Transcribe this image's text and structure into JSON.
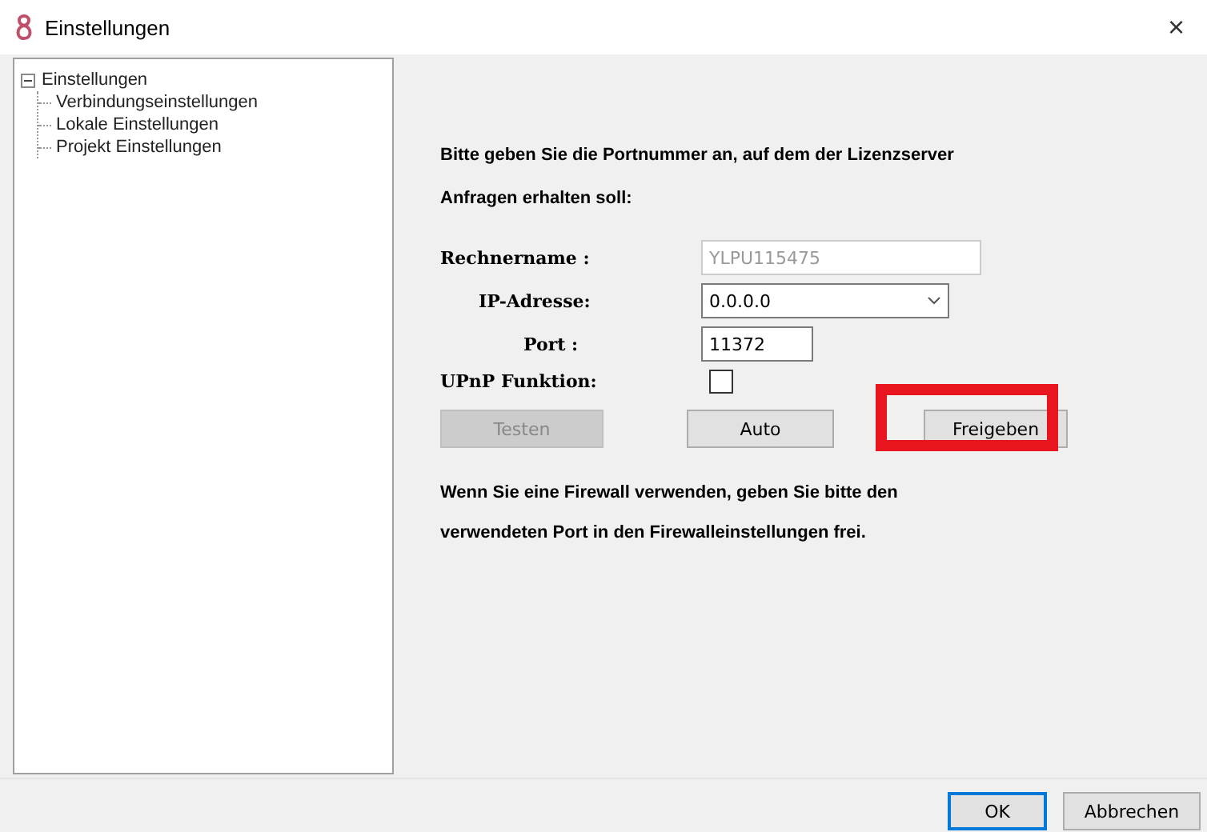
{
  "window": {
    "title": "Einstellungen",
    "close": "×"
  },
  "tree": {
    "label": "Einstellungen",
    "expanded": true,
    "children": [
      {
        "label": "Verbindungseinstellungen"
      },
      {
        "label": "Lokale Einstellungen"
      },
      {
        "label": "Projekt Einstellungen"
      }
    ]
  },
  "intro": "Bitte geben Sie die Portnummer an, auf dem der Lizenzserver Anfragen erhalten soll:",
  "fields": [
    {
      "kind": "text",
      "label": "Rechnername :",
      "value": "YLPU115475",
      "disabled": true
    },
    {
      "kind": "select",
      "label": "IP-Adresse:",
      "value": "0.0.0.0"
    },
    {
      "kind": "port",
      "label": "Port :",
      "value": "11372",
      "disabled": false
    }
  ],
  "upnp": {
    "label": "UPnP Funktion:",
    "checked": false
  },
  "actions": [
    {
      "label": "Testen",
      "disabled": true,
      "highlighted": false
    },
    {
      "label": "Auto",
      "disabled": false,
      "highlighted": false
    },
    {
      "label": "Freigeben",
      "disabled": false,
      "highlighted": true
    }
  ],
  "note": "Wenn Sie eine Firewall verwenden, geben Sie bitte den verwendeten Port in den Firewalleinstellungen frei.",
  "buttons": [
    {
      "label": "OK",
      "default": true
    },
    {
      "label": "Abbrechen",
      "default": false
    }
  ]
}
